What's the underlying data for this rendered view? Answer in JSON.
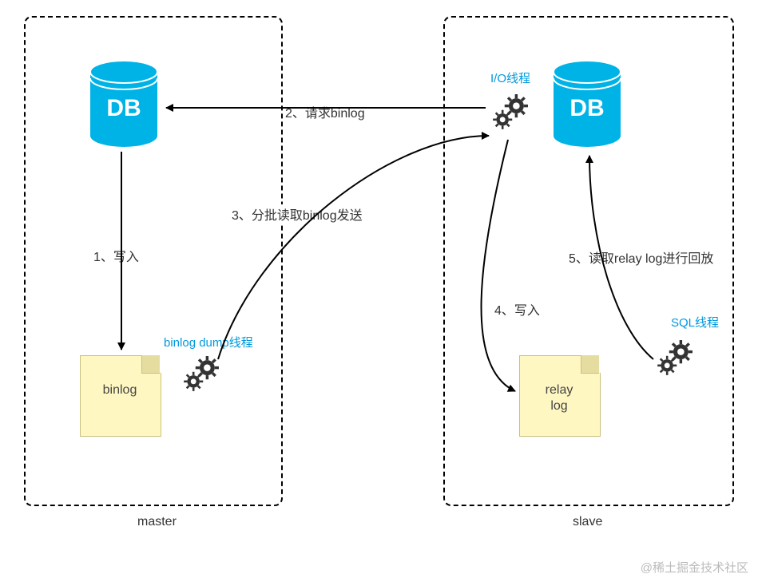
{
  "diagram": {
    "master": {
      "title": "master",
      "db_label": "DB",
      "file_label": "binlog",
      "thread_label": "binlog dump线程"
    },
    "slave": {
      "title": "slave",
      "db_label": "DB",
      "file_label": "relay\nlog",
      "io_thread_label": "I/O线程",
      "sql_thread_label": "SQL线程"
    },
    "steps": {
      "s1": "1、写入",
      "s2": "2、请求binlog",
      "s3": "3、分批读取binlog发送",
      "s4": "4、写入",
      "s5": "5、读取relay log进行回放"
    },
    "watermark": "@稀土掘金技术社区",
    "colors": {
      "accent": "#00b3e6",
      "text_blue": "#0099dd"
    }
  }
}
